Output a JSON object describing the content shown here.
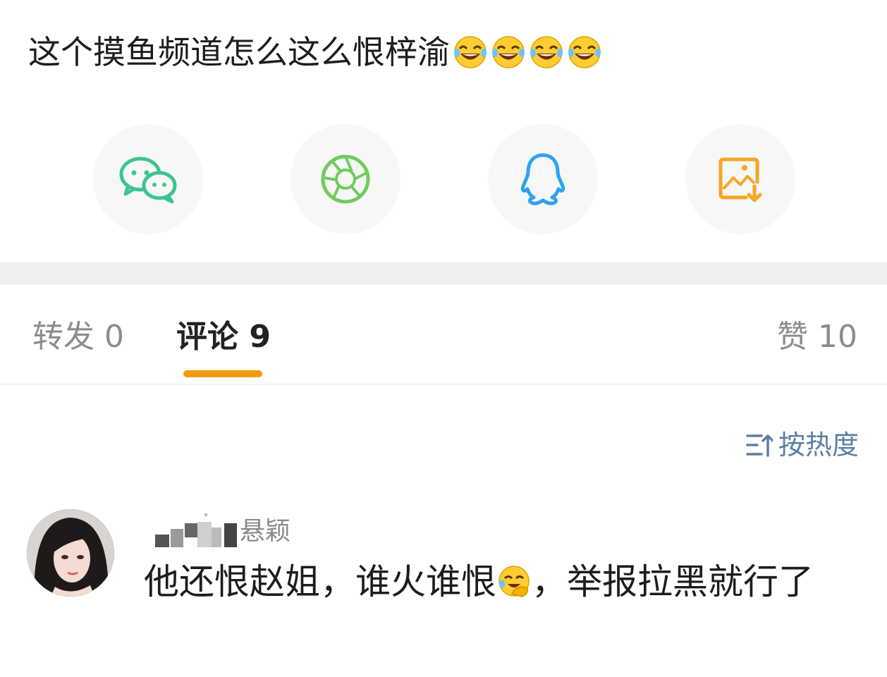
{
  "post": {
    "text": "这个摸鱼频道怎么这么恨梓渝",
    "emojis": [
      "laughing-tears-emoji",
      "laughing-tears-emoji",
      "laughing-tears-emoji",
      "laughing-tears-emoji"
    ]
  },
  "share": {
    "buttons": [
      {
        "name": "wechat",
        "icon": "wechat-icon",
        "color": "#3cc58f"
      },
      {
        "name": "moments",
        "icon": "moments-icon",
        "color": "#6fcc5b"
      },
      {
        "name": "qq",
        "icon": "qq-icon",
        "color": "#2fa3f0"
      },
      {
        "name": "save-image",
        "icon": "save-image-icon",
        "color": "#f5a623"
      }
    ]
  },
  "tabs": {
    "repost": {
      "label": "转发",
      "count": "0"
    },
    "comment": {
      "label": "评论",
      "count": "9"
    },
    "like": {
      "label": "赞",
      "count": "10"
    },
    "active": "comment",
    "indicator_color": "#f59a0f"
  },
  "sort": {
    "label": "按热度",
    "icon": "sort-icon"
  },
  "comment": {
    "username_visible": "颖",
    "username_partial": "悬颖",
    "text_before_emoji": "他还恨赵姐，谁火谁恨",
    "emoji": "facepalm-cry-emoji",
    "text_after_emoji": "，举报拉黑就行了"
  }
}
